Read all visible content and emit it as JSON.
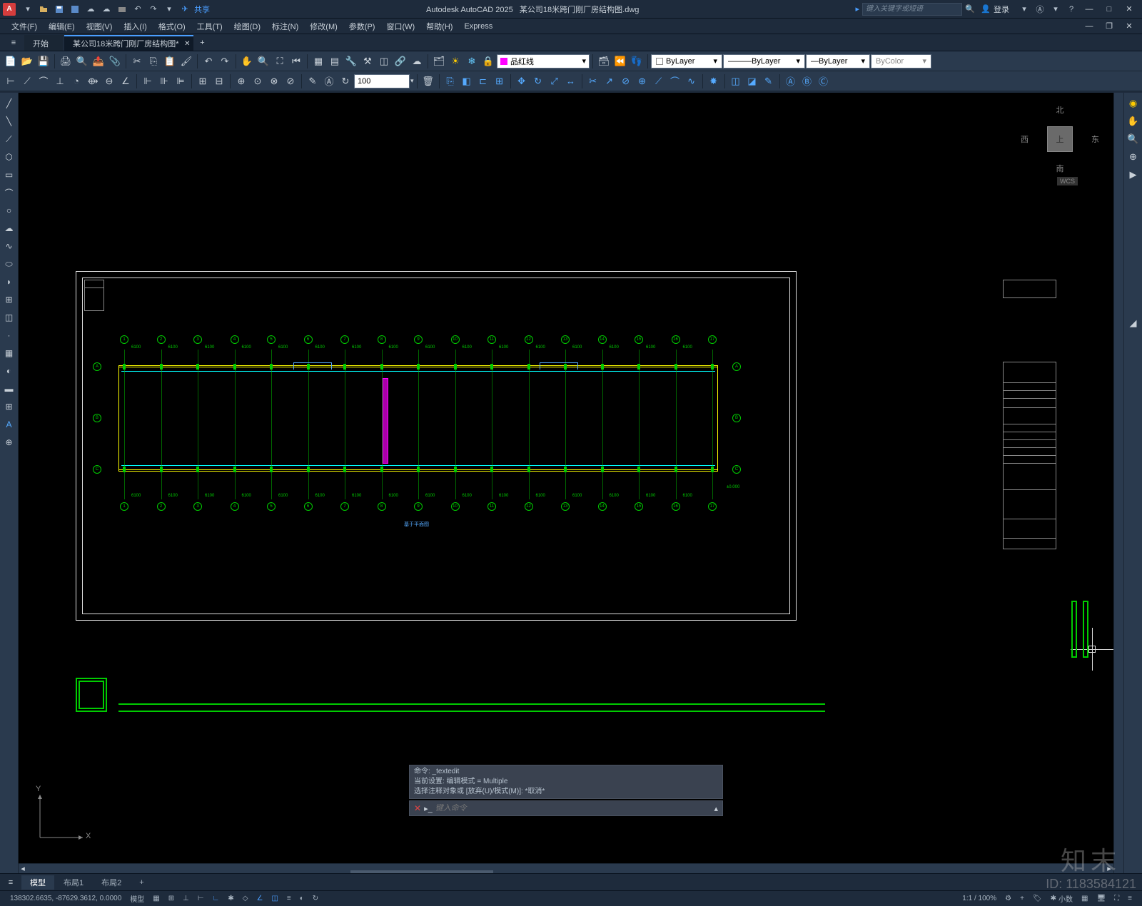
{
  "titlebar": {
    "app": "Autodesk AutoCAD 2025",
    "file": "某公司18米跨门刚厂房结构图.dwg",
    "share": "共享",
    "search_placeholder": "键入关键字或短语",
    "login": "登录"
  },
  "menubar": [
    "文件(F)",
    "编辑(E)",
    "视图(V)",
    "插入(I)",
    "格式(O)",
    "工具(T)",
    "绘图(D)",
    "标注(N)",
    "修改(M)",
    "参数(P)",
    "窗口(W)",
    "帮助(H)",
    "Express"
  ],
  "doctabs": {
    "start": "开始",
    "active": "某公司18米跨门刚厂房结构图*"
  },
  "toolbar": {
    "layer_name": "品红线",
    "linescale": "100",
    "bylayer": "ByLayer",
    "bycolor": "ByColor"
  },
  "viewcube": {
    "top": "上",
    "n": "北",
    "s": "南",
    "e": "东",
    "w": "西",
    "wcs": "WCS"
  },
  "ucs": {
    "x": "X",
    "y": "Y"
  },
  "plan": {
    "title": "基于平面图",
    "elev_label": "±0.000"
  },
  "cmd": {
    "line1": "命令:  _textedit",
    "line2": "当前设置: 编辑模式 = Multiple",
    "line3": "选择注释对象或 [放弃(U)/模式(M)]: *取消*",
    "placeholder": "键入命令"
  },
  "layout_tabs": [
    "模型",
    "布局1",
    "布局2"
  ],
  "statusbar": {
    "coords": "138302.6635, -87629.3612, 0.0000",
    "model": "模型",
    "scale": "1:1 / 100%",
    "decimal": "小数"
  },
  "watermark": {
    "brand": "知末",
    "id": "ID: 1183584121"
  }
}
